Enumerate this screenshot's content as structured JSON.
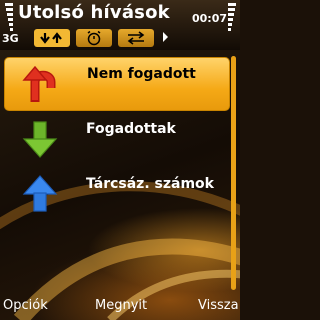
{
  "header": {
    "title": "Utolsó hívások",
    "time": "00:07",
    "network": "3G"
  },
  "tabs": [
    {
      "name": "tab-recent-calls",
      "icon": "down-up-arrows-icon",
      "active": true
    },
    {
      "name": "tab-call-duration",
      "icon": "timer-icon",
      "active": false
    },
    {
      "name": "tab-data-counter",
      "icon": "swap-arrows-icon",
      "active": false
    }
  ],
  "list": {
    "items": [
      {
        "label": "Nem fogadott",
        "icon": "missed-call-red-arrow-icon",
        "selected": true
      },
      {
        "label": "Fogadottak",
        "icon": "received-green-down-arrow-icon",
        "selected": false
      },
      {
        "label": "Tárcsáz. számok",
        "icon": "dialed-blue-up-arrow-icon",
        "selected": false
      }
    ]
  },
  "softkeys": {
    "left": "Opciók",
    "middle": "Megnyit",
    "right": "Vissza"
  },
  "colors": {
    "highlight": "#f5a916",
    "accent": "#e8a117",
    "missed": "#d9261c",
    "received": "#6cb52a",
    "dialed": "#2f7be0"
  }
}
